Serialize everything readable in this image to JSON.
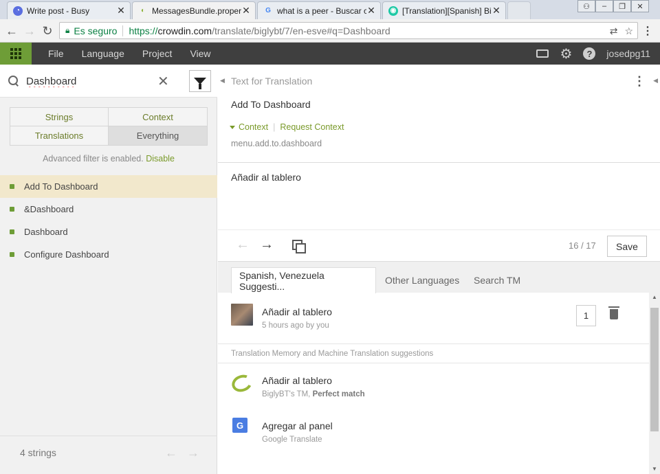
{
  "browser": {
    "tabs": [
      {
        "title": "Write post - Busy",
        "icon": "busy-icon"
      },
      {
        "title": "MessagesBundle.properti",
        "icon": "crowdin-icon"
      },
      {
        "title": "what is a peer - Buscar co",
        "icon": "google-icon"
      },
      {
        "title": "[Translation][Spanish] Big",
        "icon": "steemit-icon"
      }
    ],
    "secure_label": "Es seguro",
    "url_scheme": "https://",
    "url_host": "crowdin.com",
    "url_path": "/translate/biglybt/7/en-esve#q=Dashboard"
  },
  "topbar": {
    "menu": [
      "File",
      "Language",
      "Project",
      "View"
    ],
    "username": "josedpg11"
  },
  "left": {
    "search_value": "Dashboard",
    "filter_tabs": [
      "Strings",
      "Context",
      "Translations",
      "Everything"
    ],
    "advanced_filter_text": "Advanced filter is enabled.",
    "disable_link": "Disable",
    "strings": [
      "Add To Dashboard",
      "&Dashboard",
      "Dashboard",
      "Configure Dashboard"
    ],
    "count_text": "4 strings"
  },
  "right": {
    "text_for_translation_label": "Text for Translation",
    "source_text": "Add To Dashboard",
    "context_link": "Context",
    "request_context_link": "Request Context",
    "string_key": "menu.add.to.dashboard",
    "translation_text": "Añadir al tablero",
    "progress": "16 / 17",
    "save_label": "Save",
    "suggestion_tabs": [
      "Spanish, Venezuela Suggesti...",
      "Other Languages",
      "Search TM"
    ],
    "user_suggestion": {
      "text": "Añadir al tablero",
      "meta": "5 hours ago by you",
      "votes": "1"
    },
    "tm_header": "Translation Memory and Machine Translation suggestions",
    "tm_suggestions": [
      {
        "text": "Añadir al tablero",
        "source": "BiglyBT's TM,",
        "match": "Perfect match",
        "icon": "crowdin-tm-icon"
      },
      {
        "text": "Agregar al panel",
        "source": "Google Translate",
        "match": "",
        "icon": "google-translate-icon"
      }
    ]
  },
  "colors": {
    "accent_green": "#6e9d37",
    "topbar_dark": "#3f3f3f",
    "active_string_bg": "#f2e8cc",
    "link_green": "#7a9a2a"
  }
}
